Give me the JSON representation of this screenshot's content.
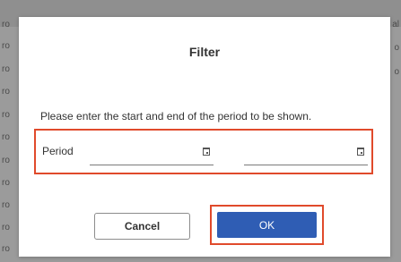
{
  "background": {
    "left_cells": [
      "ro",
      "ro",
      "ro",
      "ro",
      "ro",
      "ro",
      "ro",
      "ro",
      "ro",
      "ro",
      "ro"
    ],
    "right_cells": [
      "al",
      "o",
      "o"
    ]
  },
  "dialog": {
    "title": "Filter",
    "message": "Please enter the start and end of the period to be shown.",
    "period_label": "Period",
    "start_date_value": "",
    "end_date_value": "",
    "cancel_label": "Cancel",
    "ok_label": "OK"
  },
  "colors": {
    "primary": "#2f5db4",
    "highlight": "#e04a2b"
  },
  "icons": {
    "date_picker": "calendar-icon"
  }
}
